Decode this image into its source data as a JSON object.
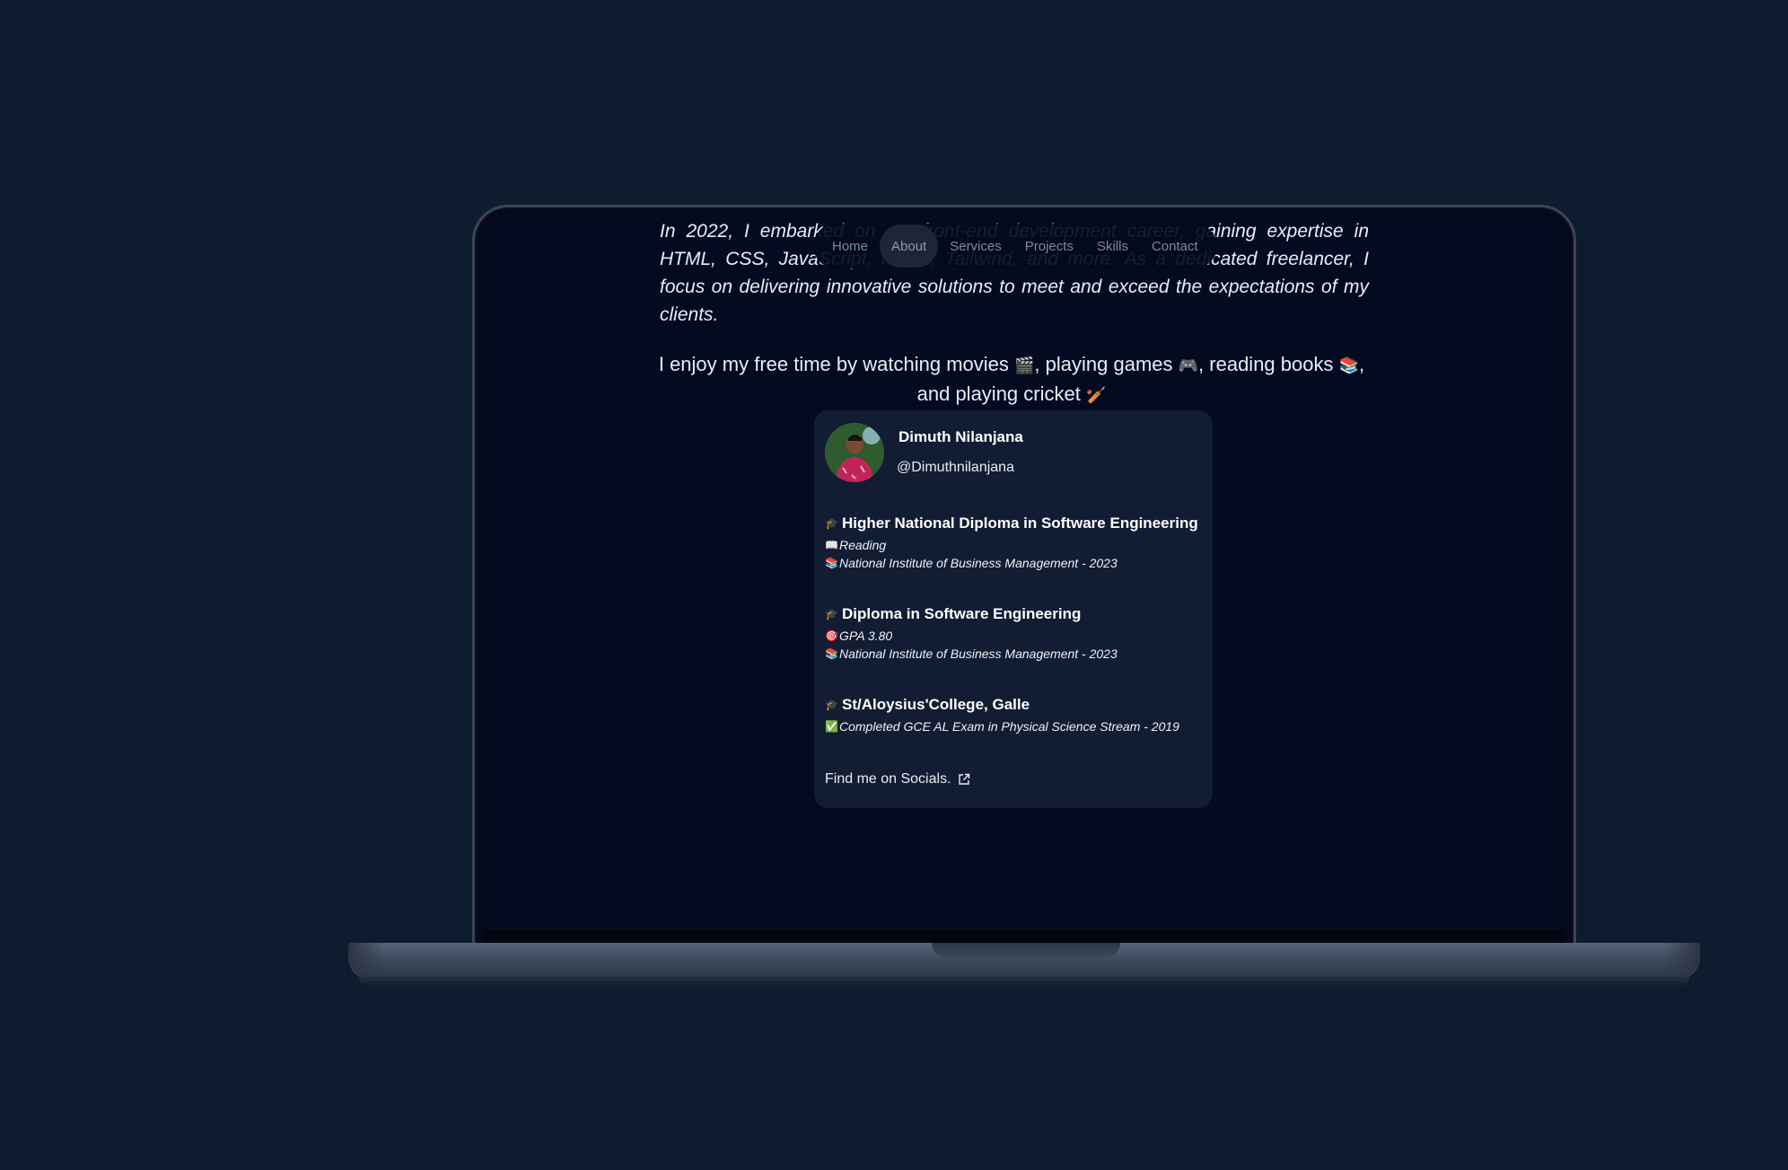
{
  "about": {
    "paragraph1": "In 2022, I embarked on my front-end development career, gaining expertise in HTML, CSS, JavaScript, React, Tailwind, and more. As a dedicated freelancer, I focus on delivering innovative solutions to meet and exceed the expectations of my clients.",
    "paragraph2_part1": "I enjoy my free time by watching movies ",
    "emoji_movies": "🎬",
    "paragraph2_part2": ", playing games ",
    "emoji_games": "🎮",
    "paragraph2_part3": ", reading books ",
    "emoji_books": "📚",
    "paragraph2_part4": ", and playing cricket ",
    "emoji_cricket": "🏏"
  },
  "nav": {
    "items": [
      {
        "label": "Home",
        "active": false
      },
      {
        "label": "About",
        "active": true
      },
      {
        "label": "Services",
        "active": false
      },
      {
        "label": "Projects",
        "active": false
      },
      {
        "label": "Skills",
        "active": false
      },
      {
        "label": "Contact",
        "active": false
      }
    ]
  },
  "profile": {
    "name": "Dimuth Nilanjana",
    "handle": "@Dimuthnilanjana",
    "education": [
      {
        "title": "Higher National Diploma in Software Engineering",
        "details": [
          {
            "icon": "📖",
            "text": "Reading"
          },
          {
            "icon": "📚",
            "text": "National Institute of Business Management - 2023"
          }
        ]
      },
      {
        "title": "Diploma in Software Engineering",
        "details": [
          {
            "icon": "🎯",
            "text": "GPA 3.80"
          },
          {
            "icon": "📚",
            "text": "National Institute of Business Management - 2023"
          }
        ]
      },
      {
        "title": "St/Aloysius'College, Galle",
        "details": [
          {
            "icon": "✅",
            "text": "Completed GCE AL Exam in Physical Science Stream - 2019"
          }
        ]
      }
    ],
    "socials_label": "Find me on Socials.",
    "title_icon": "🎓"
  },
  "colors": {
    "page_background": "#0f1c2f",
    "screen_background": "#040b21",
    "card_background": "#121d33",
    "nav_active": "#1c2638"
  }
}
